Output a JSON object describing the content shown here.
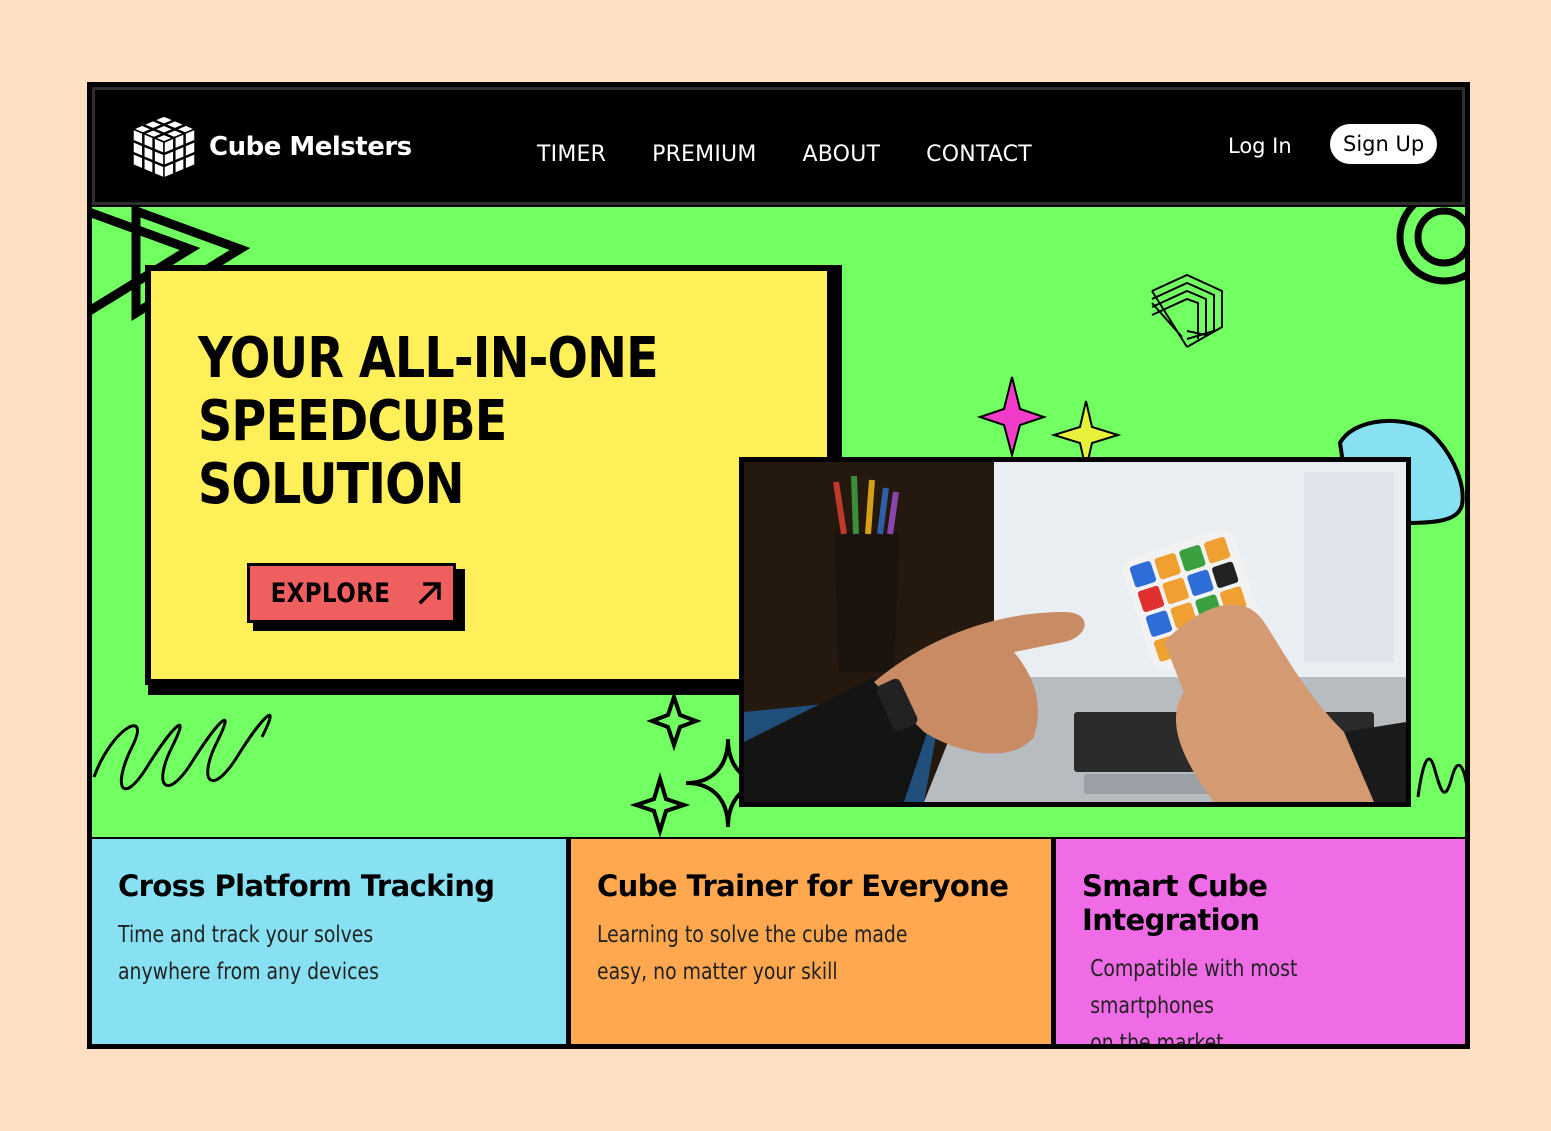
{
  "brand": {
    "name": "Cube Melsters"
  },
  "nav": {
    "items": [
      "TIMER",
      "PREMIUM",
      "ABOUT",
      "CONTACT"
    ]
  },
  "auth": {
    "login": "Log In",
    "signup": "Sign Up"
  },
  "hero": {
    "headline_lines": [
      "YOUR ALL-IN-ONE",
      "SPEEDCUBE",
      "SOLUTION"
    ],
    "cta_label": "EXPLORE"
  },
  "features": [
    {
      "title": "Cross Platform Tracking",
      "lines": [
        "Time and track your solves",
        "anywhere from any devices"
      ]
    },
    {
      "title": "Cube Trainer for Everyone",
      "lines": [
        "Learning to solve the cube made",
        "easy, no matter your skill"
      ]
    },
    {
      "title": "Smart Cube Integration",
      "lines": [
        "Compatible with most smartphones",
        "on the market"
      ]
    }
  ],
  "colors": {
    "page_bg": "#ffdfc3",
    "hero_bg": "#72ff62",
    "card_yellow": "#fff05a",
    "cta": "#f05f5f",
    "feature_blue": "#88e1f2",
    "feature_orange": "#ffa84f",
    "feature_pink": "#f06ce6"
  }
}
